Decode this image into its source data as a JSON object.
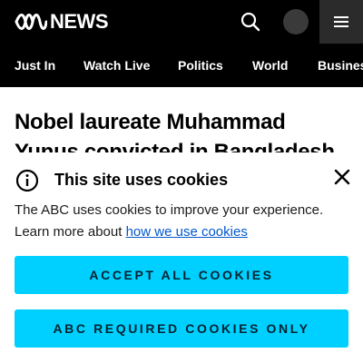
{
  "header": {
    "brand": "NEWS",
    "search_icon": "search-icon",
    "menu_icon": "hamburger-menu-icon",
    "background": "#000000"
  },
  "nav": {
    "items": [
      {
        "label": "Just In"
      },
      {
        "label": "Watch Live"
      },
      {
        "label": "Politics"
      },
      {
        "label": "World"
      },
      {
        "label": "Business"
      }
    ]
  },
  "article": {
    "headline": "Nobel laureate Muhammad Yunus convicted in Bangladesh"
  },
  "cookie_banner": {
    "title": "This site uses cookies",
    "body_text": "The ABC uses cookies to improve your experience. Learn more about ",
    "link_text": "how we use cookies",
    "accept_all_label": "ACCEPT ALL COOKIES",
    "required_only_label": "ABC REQUIRED COOKIES ONLY",
    "info_icon": "info-icon",
    "close_icon": "close-icon",
    "button_color": "#00d0ff",
    "link_color": "#0058cc"
  }
}
